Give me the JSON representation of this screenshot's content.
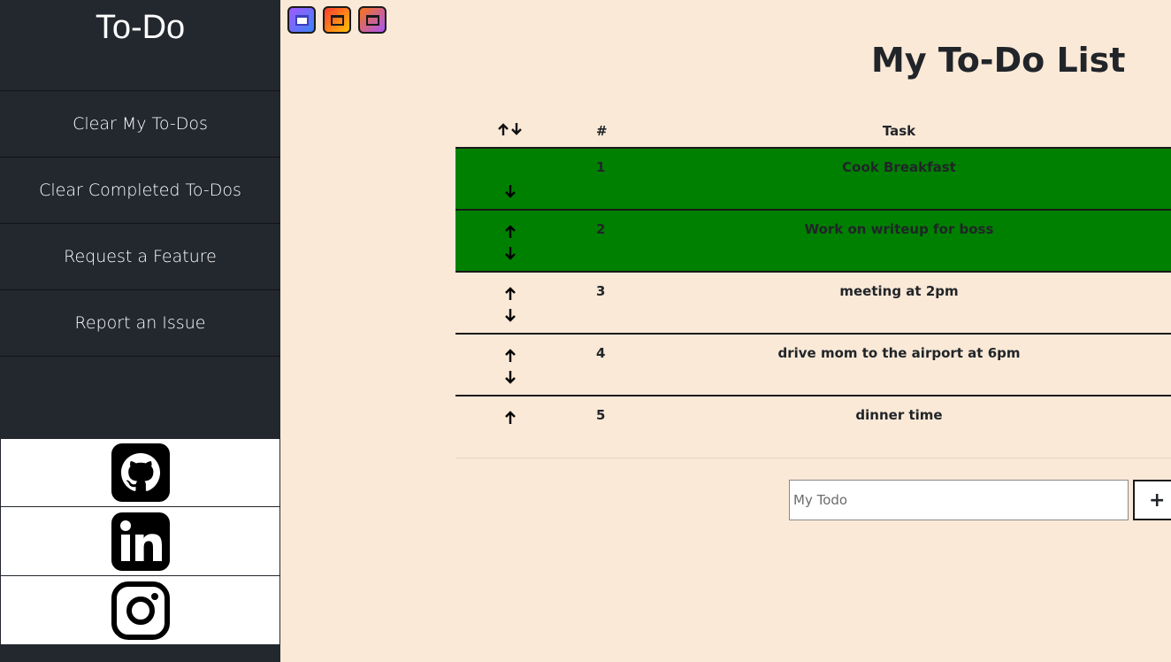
{
  "sidebar": {
    "brand": "To-Do",
    "items": [
      {
        "label": "Clear My To-Dos"
      },
      {
        "label": "Clear Completed To-Dos"
      },
      {
        "label": "Request a Feature"
      },
      {
        "label": "Report an Issue"
      }
    ],
    "socials": [
      {
        "icon": "github-icon"
      },
      {
        "icon": "linkedin-icon"
      },
      {
        "icon": "instagram-icon"
      }
    ]
  },
  "themes": [
    {
      "icon": "theme-purple-icon",
      "colors": [
        "#a259ff",
        "#3b82f6"
      ]
    },
    {
      "icon": "theme-orange-icon",
      "colors": [
        "#ff3b2f",
        "#ffc107"
      ]
    },
    {
      "icon": "theme-sunset-icon",
      "colors": [
        "#f97316",
        "#a855f7"
      ]
    }
  ],
  "main": {
    "title": "My To-Do List",
    "table": {
      "headers": {
        "move": "",
        "num": "#",
        "task": "Task"
      },
      "rows": [
        {
          "num": "1",
          "task": "Cook Breakfast",
          "completed": true
        },
        {
          "num": "2",
          "task": "Work on writeup for boss",
          "completed": true
        },
        {
          "num": "3",
          "task": "meeting at 2pm",
          "completed": false
        },
        {
          "num": "4",
          "task": "drive mom to the airport at 6pm",
          "completed": false
        },
        {
          "num": "5",
          "task": "dinner time",
          "completed": false
        }
      ]
    },
    "input": {
      "placeholder": "My Todo",
      "value": ""
    },
    "add_button": "+"
  },
  "colors": {
    "page_bg": "#fae9d7",
    "sidebar_bg": "#23272e",
    "completed_row": "#008000"
  }
}
